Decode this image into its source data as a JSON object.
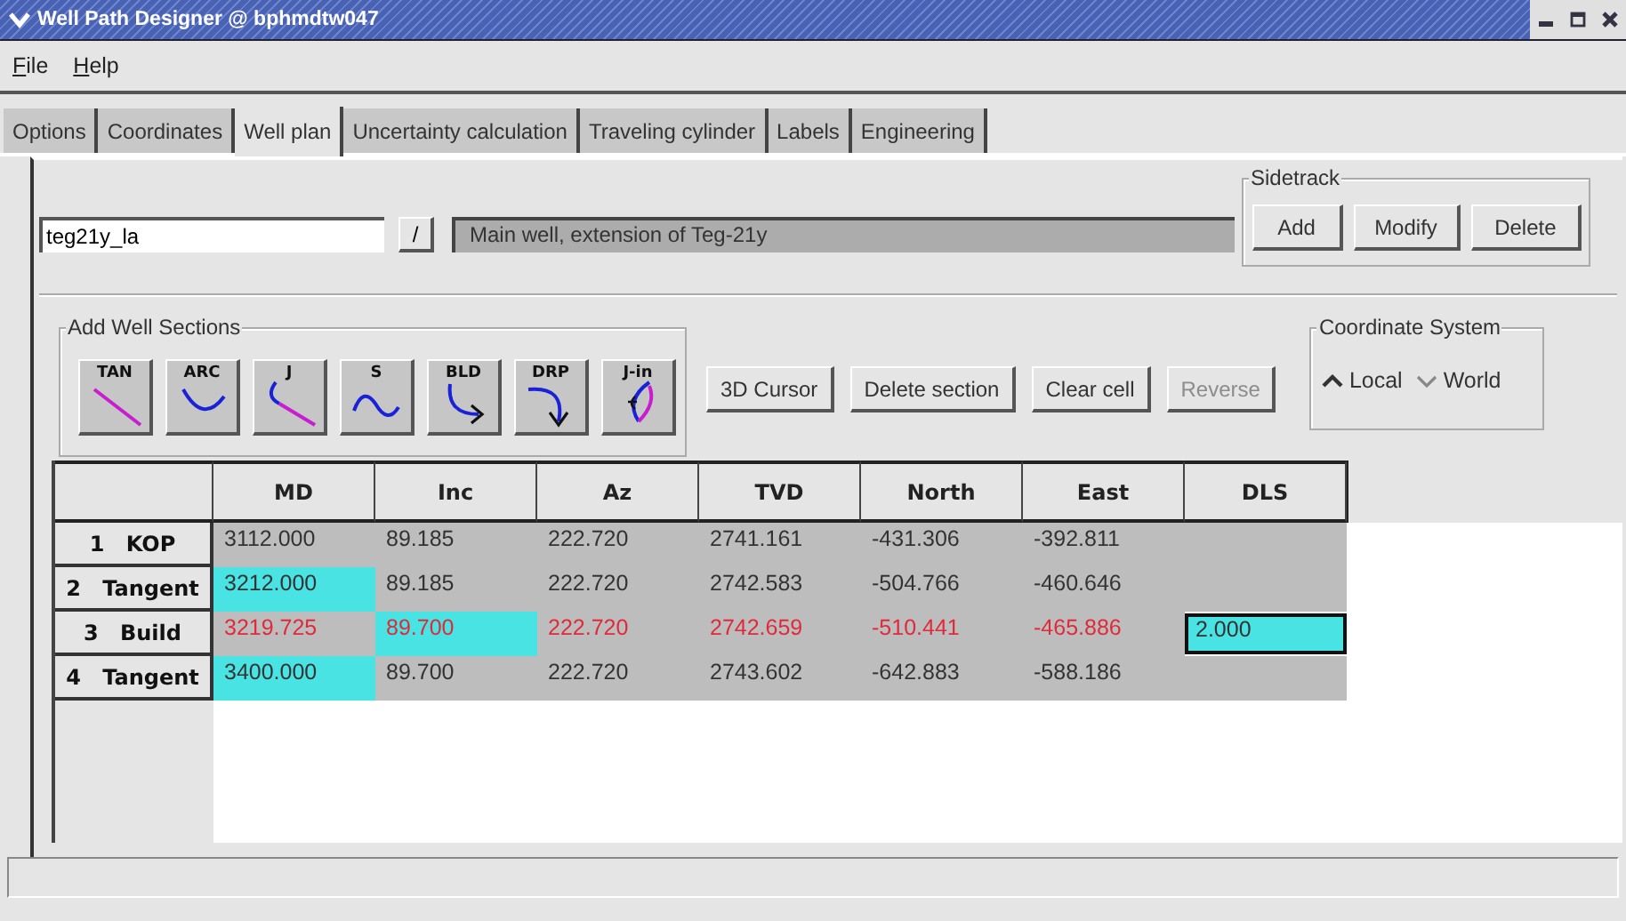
{
  "window": {
    "title": "Well Path Designer @ bphmdtw047"
  },
  "menu": [
    "File",
    "Help"
  ],
  "tabs": [
    {
      "label": "Options",
      "selected": false
    },
    {
      "label": "Coordinates",
      "selected": false
    },
    {
      "label": "Well plan",
      "selected": true
    },
    {
      "label": "Uncertainty calculation",
      "selected": false
    },
    {
      "label": "Traveling cylinder",
      "selected": false
    },
    {
      "label": "Labels",
      "selected": false
    },
    {
      "label": "Engineering",
      "selected": false
    }
  ],
  "well": {
    "name": "teg21y_la",
    "dropdown": "/",
    "description": "Main well, extension of Teg-21y"
  },
  "sidetrack": {
    "title": "Sidetrack",
    "buttons": [
      "Add",
      "Modify",
      "Delete"
    ]
  },
  "sections": {
    "title": "Add Well Sections",
    "buttons": [
      {
        "kind": "tan",
        "label": "TAN"
      },
      {
        "kind": "arc",
        "label": "ARC"
      },
      {
        "kind": "j",
        "label": "J"
      },
      {
        "kind": "s",
        "label": "S"
      },
      {
        "kind": "bld",
        "label": "BLD"
      },
      {
        "kind": "drp",
        "label": "DRP"
      },
      {
        "kind": "jin",
        "label": "J-in"
      }
    ]
  },
  "actions": [
    {
      "label": "3D Cursor",
      "disabled": false
    },
    {
      "label": "Delete section",
      "disabled": false
    },
    {
      "label": "Clear cell",
      "disabled": false
    },
    {
      "label": "Reverse",
      "disabled": true
    }
  ],
  "coordinate_system": {
    "title": "Coordinate System",
    "options": [
      {
        "label": "Local",
        "selected": true
      },
      {
        "label": "World",
        "selected": false
      }
    ]
  },
  "table": {
    "columns": [
      "MD",
      "Inc",
      "Az",
      "TVD",
      "North",
      "East",
      "DLS"
    ],
    "rows": [
      {
        "label": "1 KOP",
        "modified": false,
        "cells": [
          {
            "text": "3112.000",
            "highlighted": false,
            "selected": false
          },
          {
            "text": "89.185",
            "highlighted": false,
            "selected": false
          },
          {
            "text": "222.720",
            "highlighted": false,
            "selected": false
          },
          {
            "text": "2741.161",
            "highlighted": false,
            "selected": false
          },
          {
            "text": "-431.306",
            "highlighted": false,
            "selected": false
          },
          {
            "text": "-392.811",
            "highlighted": false,
            "selected": false
          }
        ]
      },
      {
        "label": "2 Tangent",
        "modified": false,
        "cells": [
          {
            "text": "3212.000",
            "highlighted": true,
            "selected": false
          },
          {
            "text": "89.185",
            "highlighted": false,
            "selected": false
          },
          {
            "text": "222.720",
            "highlighted": false,
            "selected": false
          },
          {
            "text": "2742.583",
            "highlighted": false,
            "selected": false
          },
          {
            "text": "-504.766",
            "highlighted": false,
            "selected": false
          },
          {
            "text": "-460.646",
            "highlighted": false,
            "selected": false
          }
        ]
      },
      {
        "label": "3 Build",
        "modified": true,
        "cells": [
          {
            "text": "3219.725",
            "highlighted": false,
            "selected": false
          },
          {
            "text": "89.700",
            "highlighted": true,
            "selected": false
          },
          {
            "text": "222.720",
            "highlighted": false,
            "selected": false
          },
          {
            "text": "2742.659",
            "highlighted": false,
            "selected": false
          },
          {
            "text": "-510.441",
            "highlighted": false,
            "selected": false
          },
          {
            "text": "-465.886",
            "highlighted": false,
            "selected": false
          },
          {
            "text": "2.000",
            "highlighted": true,
            "selected": true
          }
        ]
      },
      {
        "label": "4 Tangent",
        "modified": false,
        "cells": [
          {
            "text": "3400.000",
            "highlighted": true,
            "selected": false
          },
          {
            "text": "89.700",
            "highlighted": false,
            "selected": false
          },
          {
            "text": "222.720",
            "highlighted": false,
            "selected": false
          },
          {
            "text": "2743.602",
            "highlighted": false,
            "selected": false
          },
          {
            "text": "-642.883",
            "highlighted": false,
            "selected": false
          },
          {
            "text": "-588.186",
            "highlighted": false,
            "selected": false
          }
        ]
      }
    ]
  }
}
